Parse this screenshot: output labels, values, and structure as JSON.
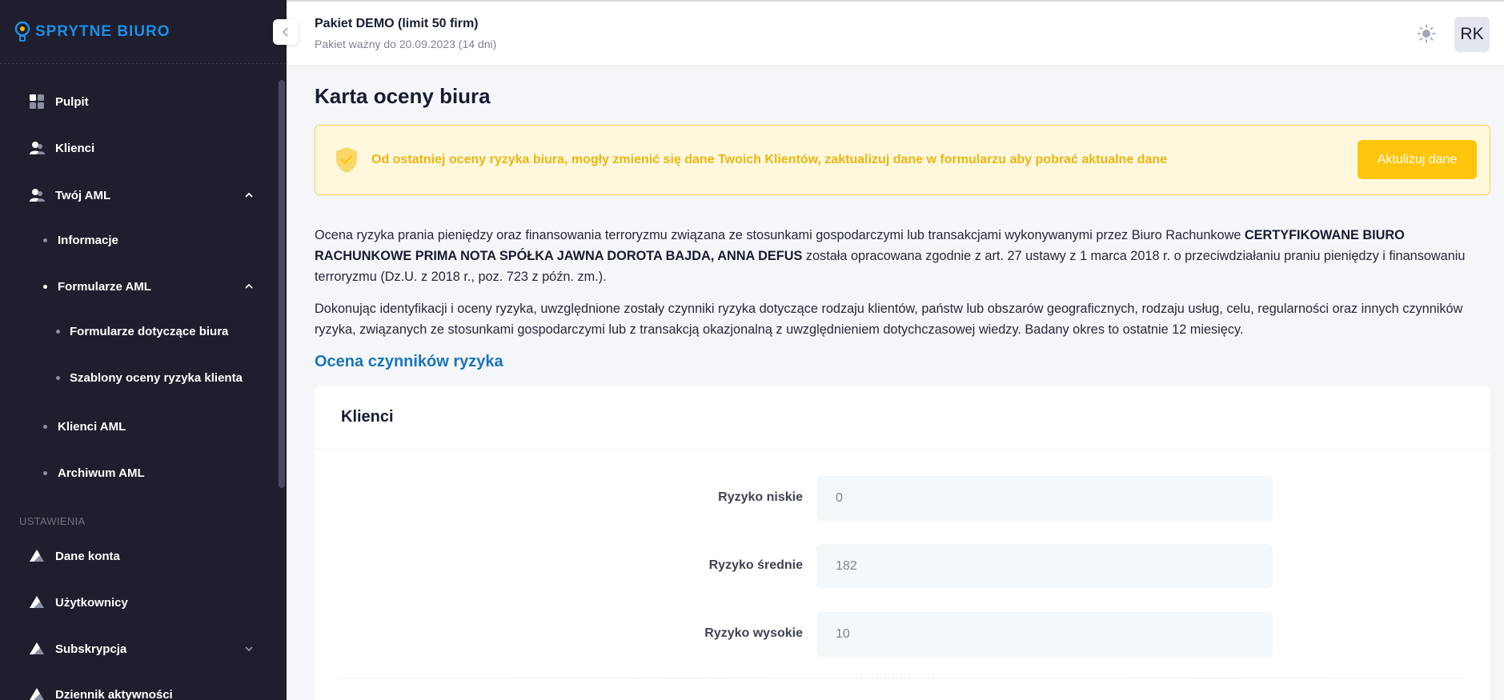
{
  "brand": {
    "name": "SPRYTNE BIURO",
    "color": "#1f8ee6"
  },
  "sidebar": {
    "items": [
      {
        "label": "Pulpit",
        "icon": "dashboard-icon"
      },
      {
        "label": "Klienci",
        "icon": "users-icon"
      },
      {
        "label": "Twój AML",
        "icon": "users-icon",
        "expanded": true
      },
      {
        "label": "Informacje"
      },
      {
        "label": "Formularze AML",
        "expanded": true
      },
      {
        "label": "Formularze dotyczące biura"
      },
      {
        "label": "Szablony oceny ryzyka klienta"
      },
      {
        "label": "Klienci AML"
      },
      {
        "label": "Archiwum AML"
      }
    ],
    "section_title": "USTAWIENIA",
    "settings_items": [
      {
        "label": "Dane konta",
        "icon": "triangle-icon"
      },
      {
        "label": "Użytkownicy",
        "icon": "triangle-icon"
      },
      {
        "label": "Subskrypcja",
        "icon": "triangle-icon",
        "expanded": false
      },
      {
        "label": "Dziennik aktywności",
        "icon": "triangle-icon"
      }
    ]
  },
  "header": {
    "package_title": "Pakiet DEMO (limit 50 firm)",
    "package_subtitle": "Pakiet ważny do 20.09.2023 (14 dni)",
    "avatar_initials": "RK"
  },
  "main": {
    "title": "Karta oceny biura",
    "alert": {
      "message": "Od ostatniej oceny ryzyka biura, mogły zmienić się dane Twoich Klientów, zaktualizuj dane w formularzu aby pobrać aktualne dane",
      "button_label": "Aktulizuj dane",
      "accent": "#ffc50a"
    },
    "paragraph1": {
      "text_before": "Ocena ryzyka prania pieniędzy oraz finansowania terroryzmu związana ze stosunkami gospodarczymi lub transakcjami wykonywanymi przez Biuro Rachunkowe ",
      "bold": "CERTYFIKOWANE BIURO RACHUNKOWE PRIMA NOTA SPÓŁKA JAWNA DOROTA BAJDA, ANNA DEFUS",
      "text_after": " została opracowana zgodnie z art. 27 ustawy z 1 marca 2018 r. o przeciwdziałaniu praniu pieniędzy i finansowaniu terroryzmu (Dz.U. z 2018 r., poz. 723 z późn. zm.)."
    },
    "paragraph2": "Dokonując identyfikacji i oceny ryzyka, uwzględnione zostały czynniki ryzyka dotyczące rodzaju klientów, państw lub obszarów geograficznych, rodzaju usług, celu, regularności oraz innych czynników ryzyka, związanych ze stosunkami gospodarczymi lub z transakcją okazjonalną z uwzględnieniem dotychczasowej wiedzy. Badany okres to ostatnie 12 miesięcy.",
    "subheading": "Ocena czynników ryzyka",
    "card": {
      "title": "Klienci",
      "rows": [
        {
          "label": "Ryzyko niskie",
          "value": "0"
        },
        {
          "label": "Ryzyko średnie",
          "value": "182"
        },
        {
          "label": "Ryzyko wysokie",
          "value": "10"
        }
      ]
    }
  }
}
